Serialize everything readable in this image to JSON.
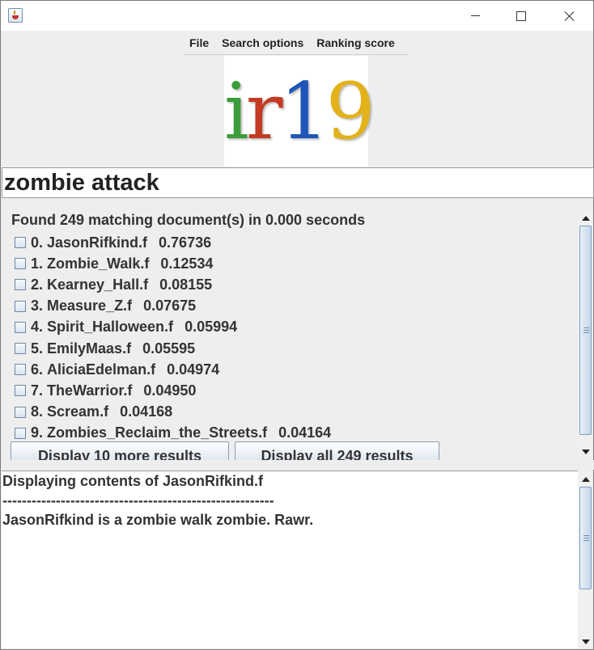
{
  "menu": {
    "items": [
      "File",
      "Search options",
      "Ranking score"
    ]
  },
  "logo": {
    "text": "ir19",
    "letters": [
      {
        "char": "i",
        "color": "#3a9c3a"
      },
      {
        "char": "r",
        "color": "#c23b22"
      },
      {
        "char": "1",
        "color": "#1f55b8"
      },
      {
        "char": "9",
        "color": "#e3b21a"
      }
    ]
  },
  "search": {
    "query": "zombie attack"
  },
  "results": {
    "summary": "Found 249 matching document(s) in 0.000 seconds",
    "items": [
      {
        "index": "0.",
        "name": "JasonRifkind.f",
        "score": "0.76736"
      },
      {
        "index": "1.",
        "name": "Zombie_Walk.f",
        "score": "0.12534"
      },
      {
        "index": "2.",
        "name": "Kearney_Hall.f",
        "score": "0.08155"
      },
      {
        "index": "3.",
        "name": "Measure_Z.f",
        "score": "0.07675"
      },
      {
        "index": "4.",
        "name": "Spirit_Halloween.f",
        "score": "0.05994"
      },
      {
        "index": "5.",
        "name": "EmilyMaas.f",
        "score": "0.05595"
      },
      {
        "index": "6.",
        "name": "AliciaEdelman.f",
        "score": "0.04974"
      },
      {
        "index": "7.",
        "name": "TheWarrior.f",
        "score": "0.04950"
      },
      {
        "index": "8.",
        "name": "Scream.f",
        "score": "0.04168"
      },
      {
        "index": "9.",
        "name": "Zombies_Reclaim_the_Streets.f",
        "score": "0.04164"
      }
    ],
    "more_label": "Display 10 more results",
    "all_label": "Display all 249 results"
  },
  "document": {
    "heading": "Displaying contents of JasonRifkind.f",
    "separator": "--------------------------------------------------------",
    "content": "JasonRifkind is a zombie walk zombie.  Rawr."
  }
}
